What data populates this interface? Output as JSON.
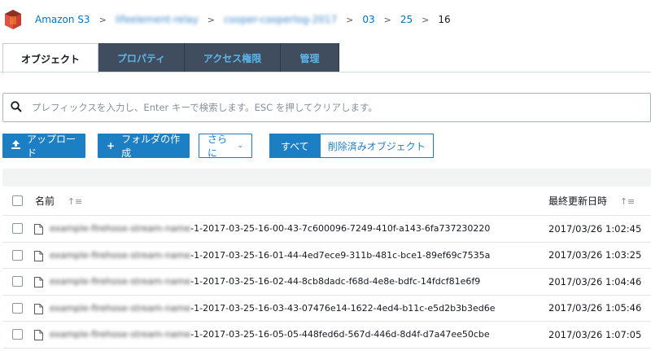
{
  "breadcrumb": {
    "root": "Amazon S3",
    "bucket": "lifeelement-relay",
    "prefix": "cooper-cooperlog-2017",
    "year_suffix": "2017",
    "month": "03",
    "day": "25",
    "hour": "16"
  },
  "tabs": [
    {
      "label": "オブジェクト",
      "active": true
    },
    {
      "label": "プロパティ",
      "active": false
    },
    {
      "label": "アクセス権限",
      "active": false
    },
    {
      "label": "管理",
      "active": false
    }
  ],
  "search": {
    "placeholder": "プレフィックスを入力し、Enter キーで検索します。ESC を押してクリアします。"
  },
  "toolbar": {
    "upload": "アップロード",
    "create_folder": "フォルダの作成",
    "more": "さらに",
    "show_all": "すべて",
    "show_deleted": "削除済みオブジェクト"
  },
  "table": {
    "col_name": "名前",
    "col_modified": "最終更新日時",
    "rows": [
      {
        "prefix": "example-firehose-stream-name",
        "suffix": "-1-2017-03-25-16-00-43-7c600096-7249-410f-a143-6fa737230220",
        "modified": "2017/03/26 1:02:45"
      },
      {
        "prefix": "example-firehose-stream-name",
        "suffix": "-1-2017-03-25-16-01-44-4ed7ece9-311b-481c-bce1-89ef69c7535a",
        "modified": "2017/03/26 1:03:25"
      },
      {
        "prefix": "example-firehose-stream-name",
        "suffix": "-1-2017-03-25-16-02-44-8cb8dadc-f68d-4e8e-bdfc-14fdcf81e6f9",
        "modified": "2017/03/26 1:04:46"
      },
      {
        "prefix": "example-firehose-stream-name",
        "suffix": "-1-2017-03-25-16-03-43-07476e14-1622-4ed4-b11c-e5d2b3b3ed6e",
        "modified": "2017/03/26 1:05:46"
      },
      {
        "prefix": "example-firehose-stream-name",
        "suffix": "-1-2017-03-25-16-05-05-448fed6d-567d-446d-8d4f-d7a47ee50cbe",
        "modified": "2017/03/26 1:07:05"
      }
    ]
  },
  "colors": {
    "link": "#0073bb",
    "primary": "#1c7fc4",
    "tab_bg": "#3f4d5e",
    "tab_text": "#5fb5e8"
  }
}
